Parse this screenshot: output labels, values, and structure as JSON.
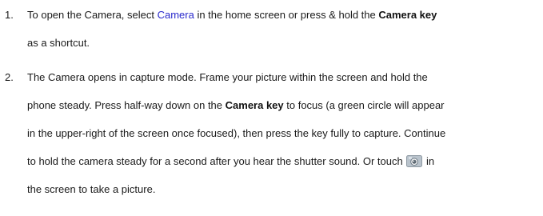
{
  "steps": [
    {
      "number": "1.",
      "lines": [
        {
          "a": "To open the Camera, select ",
          "link": "Camera",
          "b": " in the home screen or press & hold the ",
          "bold": "Camera key"
        },
        {
          "text": "as a shortcut."
        }
      ]
    },
    {
      "number": "2.",
      "lines": [
        {
          "text": "The Camera opens in capture mode. Frame your picture within the screen and hold the"
        },
        {
          "a": "phone steady. Press half-way down on the ",
          "bold": "Camera key",
          "b": " to focus (a green circle will appear"
        },
        {
          "text": "in the upper-right of the screen once focused), then press the key fully to capture. Continue"
        },
        {
          "a": "to hold the camera steady for a second after you hear the shutter sound. Or touch",
          "icon": "camera-icon",
          "b": "in"
        },
        {
          "text": "the screen to take a picture."
        }
      ]
    }
  ],
  "colors": {
    "link": "#2a2acc",
    "icon_bg": "#b9c3cc"
  }
}
